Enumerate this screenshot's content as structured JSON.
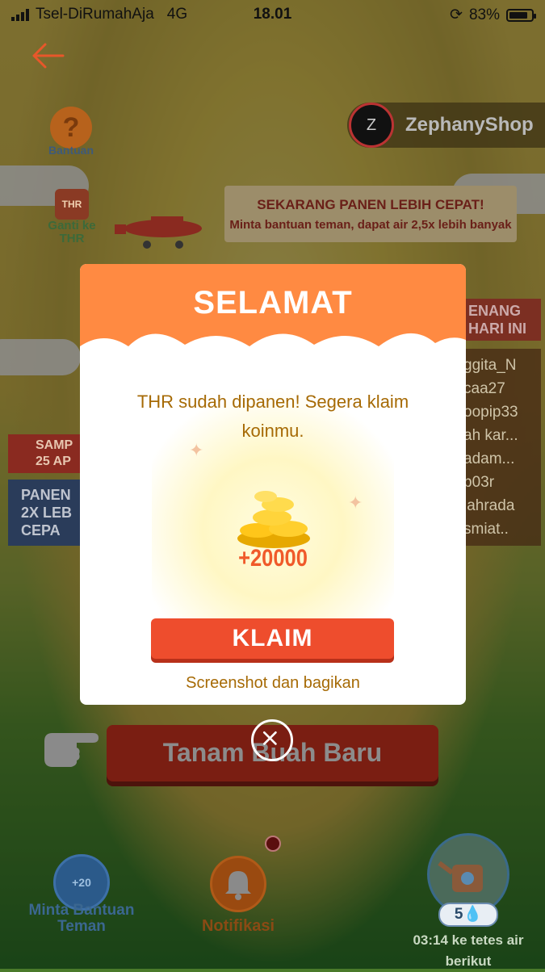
{
  "status_bar": {
    "carrier": "Tsel-DiRumahAja",
    "network": "4G",
    "time": "18.01",
    "battery_percent": "83%",
    "battery_level": 0.83
  },
  "header": {
    "shop_name": "ZephanyShop",
    "help_label": "Bantuan",
    "thr_badge": "THR",
    "thr_label": "Ganti ke THR"
  },
  "banner": {
    "line1": "SEKARANG PANEN LEBIH CEPAT!",
    "line2": "Minta bantuan teman, dapat air 2,5x lebih banyak"
  },
  "leaderboard": {
    "title": "ENANG HARI INI",
    "entries": [
      "ggita_N",
      "caa27",
      "oopip33",
      "ah kar...",
      "adam...",
      "p03r",
      "iahrada",
      "smiat.."
    ]
  },
  "left_sign": {
    "red_text": "SAMP 25 AP",
    "blue_text": "PANEN 2X LEB CEPA"
  },
  "plant_button": "Tanam Buah Baru",
  "bottom": {
    "ask_badge": "+20",
    "ask_label": "Minta Bantuan Teman",
    "notif_label": "Notifikasi",
    "water_count": "5",
    "water_timer": "03:14 ke tetes air berikut"
  },
  "modal": {
    "title": "SELAMAT",
    "message": "THR sudah dipanen! Segera klaim koinmu.",
    "reward": "+20000",
    "claim_label": "KLAIM",
    "share_label": "Screenshot dan bagikan"
  },
  "colors": {
    "accent_orange": "#ff8a42",
    "claim_red": "#ee4d2d",
    "text_gold": "#a66a05"
  }
}
